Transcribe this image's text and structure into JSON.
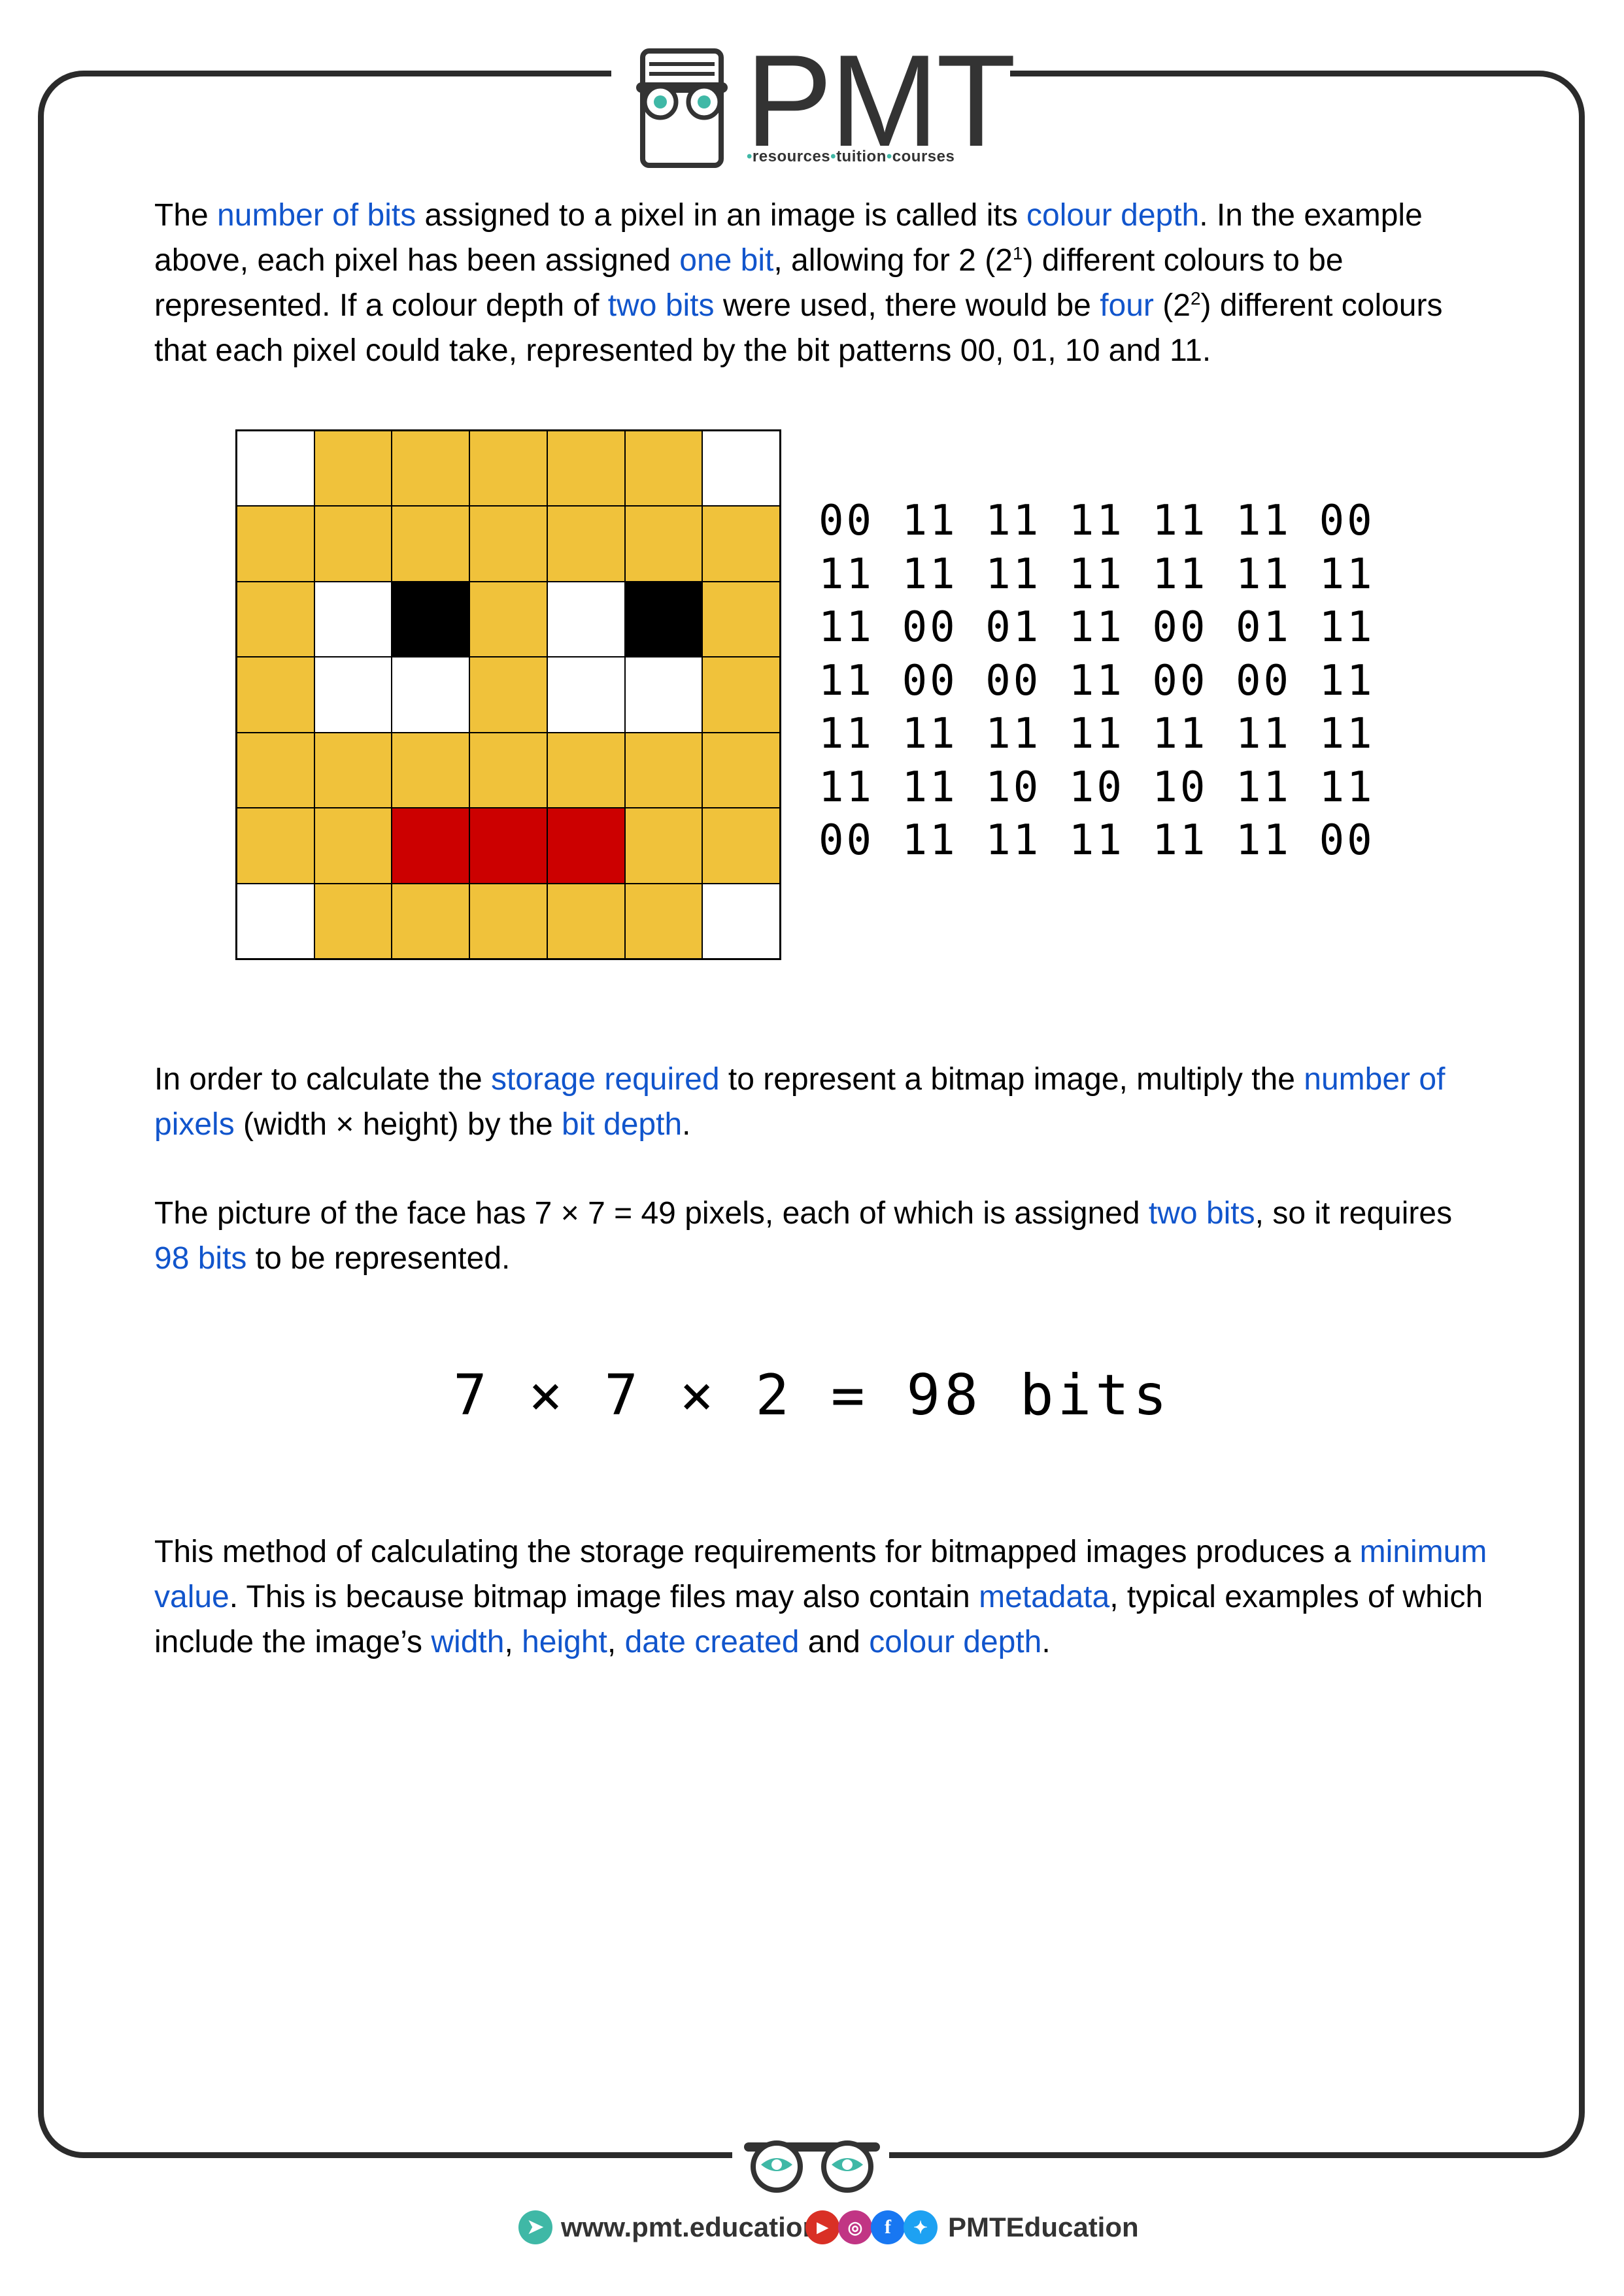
{
  "header": {
    "logo_text": "PMT",
    "logo_tagline": [
      "resources",
      "tuition",
      "courses"
    ]
  },
  "paragraphs": {
    "p1": [
      {
        "t": "The "
      },
      {
        "t": "number of bits",
        "hl": true
      },
      {
        "t": " assigned to a pixel in an image is called its "
      },
      {
        "t": "colour depth",
        "hl": true
      },
      {
        "t": ". In the example above, each pixel has been assigned "
      },
      {
        "t": "one bit",
        "hl": true
      },
      {
        "t": ", allowing for 2 (2"
      },
      {
        "t": "1",
        "sup": true
      },
      {
        "t": ") different colours to be represented. If a colour depth of "
      },
      {
        "t": "two bits",
        "hl": true
      },
      {
        "t": " were used, there would be "
      },
      {
        "t": "four",
        "hl": true
      },
      {
        "t": " (2"
      },
      {
        "t": "2",
        "sup": true
      },
      {
        "t": ") different colours that each pixel could take, represented by the bit patterns 00, 01, 10 and 11."
      }
    ],
    "p2": [
      {
        "t": "In order to calculate the "
      },
      {
        "t": "storage required",
        "hl": true
      },
      {
        "t": " to represent a bitmap image, multiply the "
      },
      {
        "t": "number of pixels",
        "hl": true
      },
      {
        "t": " (width × height) by the "
      },
      {
        "t": "bit depth",
        "hl": true
      },
      {
        "t": "."
      }
    ],
    "p3": [
      {
        "t": "The picture of the face has 7 × 7 = 49 pixels, each of which is assigned "
      },
      {
        "t": "two bits",
        "hl": true
      },
      {
        "t": ", so it requires "
      },
      {
        "t": "98 bits",
        "hl": true
      },
      {
        "t": " to be represented."
      }
    ],
    "p4": [
      {
        "t": "This method of calculating the storage requirements for bitmapped images produces a "
      },
      {
        "t": "minimum value",
        "hl": true
      },
      {
        "t": ". This is because bitmap image files may also contain "
      },
      {
        "t": "metadata",
        "hl": true
      },
      {
        "t": ", typical examples of which include the image’s "
      },
      {
        "t": "width",
        "hl": true
      },
      {
        "t": ", "
      },
      {
        "t": "height",
        "hl": true
      },
      {
        "t": ", "
      },
      {
        "t": "date created",
        "hl": true
      },
      {
        "t": " and "
      },
      {
        "t": "colour depth",
        "hl": true
      },
      {
        "t": "."
      }
    ]
  },
  "colors": {
    "highlight": "#1155cc",
    "pixel_00": "#ffffff",
    "pixel_01": "#000000",
    "pixel_10": "#cc0000",
    "pixel_11": "#f0c23b"
  },
  "pixel_grid": [
    [
      "00",
      "11",
      "11",
      "11",
      "11",
      "11",
      "00"
    ],
    [
      "11",
      "11",
      "11",
      "11",
      "11",
      "11",
      "11"
    ],
    [
      "11",
      "00",
      "01",
      "11",
      "00",
      "01",
      "11"
    ],
    [
      "11",
      "00",
      "00",
      "11",
      "00",
      "00",
      "11"
    ],
    [
      "11",
      "11",
      "11",
      "11",
      "11",
      "11",
      "11"
    ],
    [
      "11",
      "11",
      "10",
      "10",
      "10",
      "11",
      "11"
    ],
    [
      "00",
      "11",
      "11",
      "11",
      "11",
      "11",
      "00"
    ]
  ],
  "bit_rows": [
    "00 11 11 11 11 11 00",
    "11 11 11 11 11 11 11",
    "11 00 01 11 00 01 11",
    "11 00 00 11 00 00 11",
    "11 11 11 11 11 11 11",
    "11 11 10 10 10 11 11",
    "00 11 11 11 11 11 00"
  ],
  "equation": "7 × 7 × 2 = 98 bits",
  "footer": {
    "website": "www.pmt.education",
    "handle": "PMTEducation"
  }
}
